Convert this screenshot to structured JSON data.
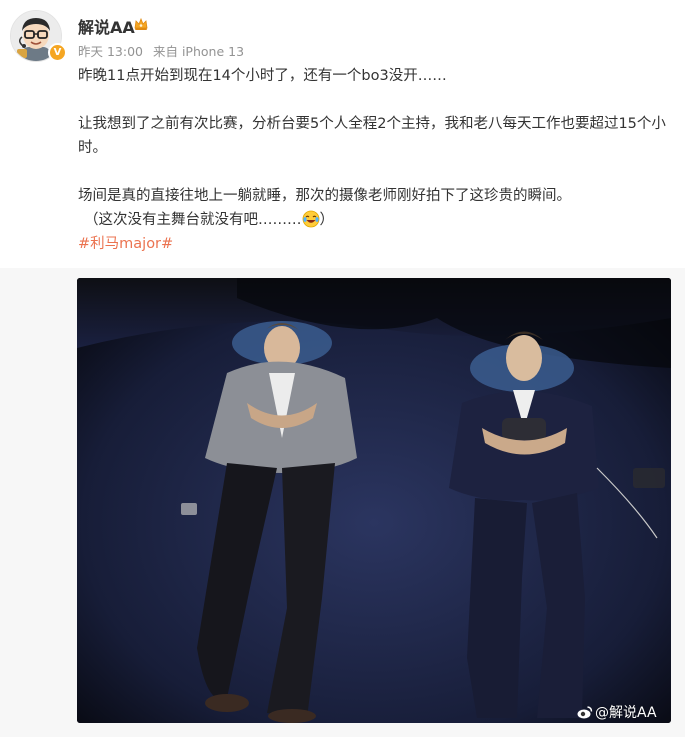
{
  "post": {
    "author": "解说AA",
    "meta": {
      "time": "昨天 13:00",
      "source": "来自 iPhone 13"
    },
    "paragraphs": [
      "昨晚11点开始到现在14个小时了，还有一个bo3没开……",
      "让我想到了之前有次比赛，分析台要5个人全程2个主持，我和老八每天工作也要超过15个小时。",
      "场间是真的直接往地上一躺就睡，那次的摄像老师刚好拍下了这珍贵的瞬间。"
    ],
    "paren_text": "（这次没有主舞台就没有吧………",
    "paren_close": "）",
    "hashtag": "#利马major#",
    "watermark": "@解说AA",
    "verified_mark": "V"
  },
  "icons": {
    "avatar": "cartoon-avatar",
    "verified": "verified-badge-icon",
    "crown": "crown-icon",
    "laugh": "laugh-cry-emoji-icon",
    "weibo": "weibo-logo-icon"
  },
  "colors": {
    "hashtag": "#eb7350",
    "meta": "#939393",
    "verified": "#f5a623",
    "crown": "#f5a623"
  }
}
